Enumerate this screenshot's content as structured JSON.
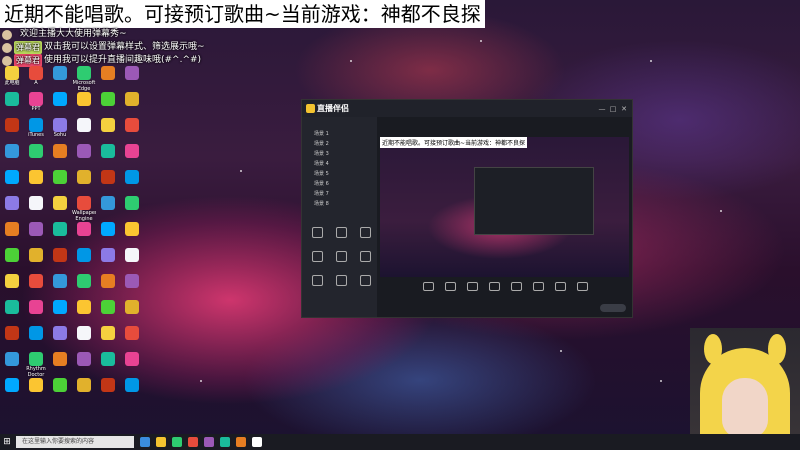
{
  "overlay": {
    "song_banner": "近期不能唱歌。可接预订歌曲~当前游戏：神都不良探",
    "chat": [
      {
        "name": "",
        "name_color": "#e9476a",
        "text": "欢迎主播大大使用弹幕秀~"
      },
      {
        "name": "弹幕君",
        "name_color": "#b7d65b",
        "text": "双击我可以设置弹幕样式、筛选展示哦~"
      },
      {
        "name": "弹幕君",
        "name_color": "#e9476a",
        "text": "使用我可以提升直播间趣味哦(#^.^#)"
      }
    ]
  },
  "desktop": {
    "icon_colors": [
      "#f4d03f",
      "#e74c3c",
      "#3498db",
      "#2ecc71",
      "#e67e22",
      "#9b59b6",
      "#1abc9c",
      "#e84393",
      "#00a8ff",
      "#fbc531",
      "#4cd137",
      "#e1b12c",
      "#c23616",
      "#0097e6",
      "#8c7ae6",
      "#f5f6fa"
    ],
    "icons": [
      "此电脑",
      "A",
      "",
      "Microsoft Edge",
      "",
      "",
      "",
      "PPT",
      "",
      "",
      "",
      "",
      "",
      "iTunes",
      "Sohu",
      "",
      "",
      "",
      "",
      "",
      "",
      "",
      "",
      "",
      "",
      "",
      "",
      "",
      "",
      "",
      "",
      "",
      "",
      "Wallpaper Engine",
      "",
      "",
      "",
      "",
      "",
      "",
      "",
      "",
      "",
      "",
      "",
      "",
      "",
      "",
      "",
      "",
      "",
      "",
      "",
      "",
      "",
      "",
      "",
      "",
      "",
      "",
      "",
      "",
      "",
      "",
      "",
      "",
      "",
      "Rhythm Doctor",
      "",
      "",
      "",
      "",
      "",
      "",
      "",
      "",
      "",
      ""
    ]
  },
  "app": {
    "title": "直播伴侣",
    "window_controls": [
      "—",
      "□",
      "✕"
    ],
    "scenes": [
      "场景 1",
      "场景 2",
      "场景 3",
      "场景 4",
      "场景 5",
      "场景 6",
      "场景 7",
      "场景 8"
    ],
    "tools": [
      "",
      "",
      "",
      "",
      "",
      "",
      "",
      "",
      ""
    ],
    "preview_banner": "近期不能唱歌。可接预订歌曲~当前游戏：神都不良探",
    "bottom_actions": [
      "",
      "",
      "",
      "",
      "",
      "",
      "",
      ""
    ],
    "start_live": ""
  },
  "taskbar": {
    "start_glyph": "⊞",
    "search_placeholder": "在这里输入你要搜索的内容",
    "app_colors": [
      "#3a8dde",
      "#f4c430",
      "#2ecc71",
      "#e74c3c",
      "#9b59b6",
      "#1abc9c",
      "#e67e22",
      "#ffffff"
    ]
  }
}
